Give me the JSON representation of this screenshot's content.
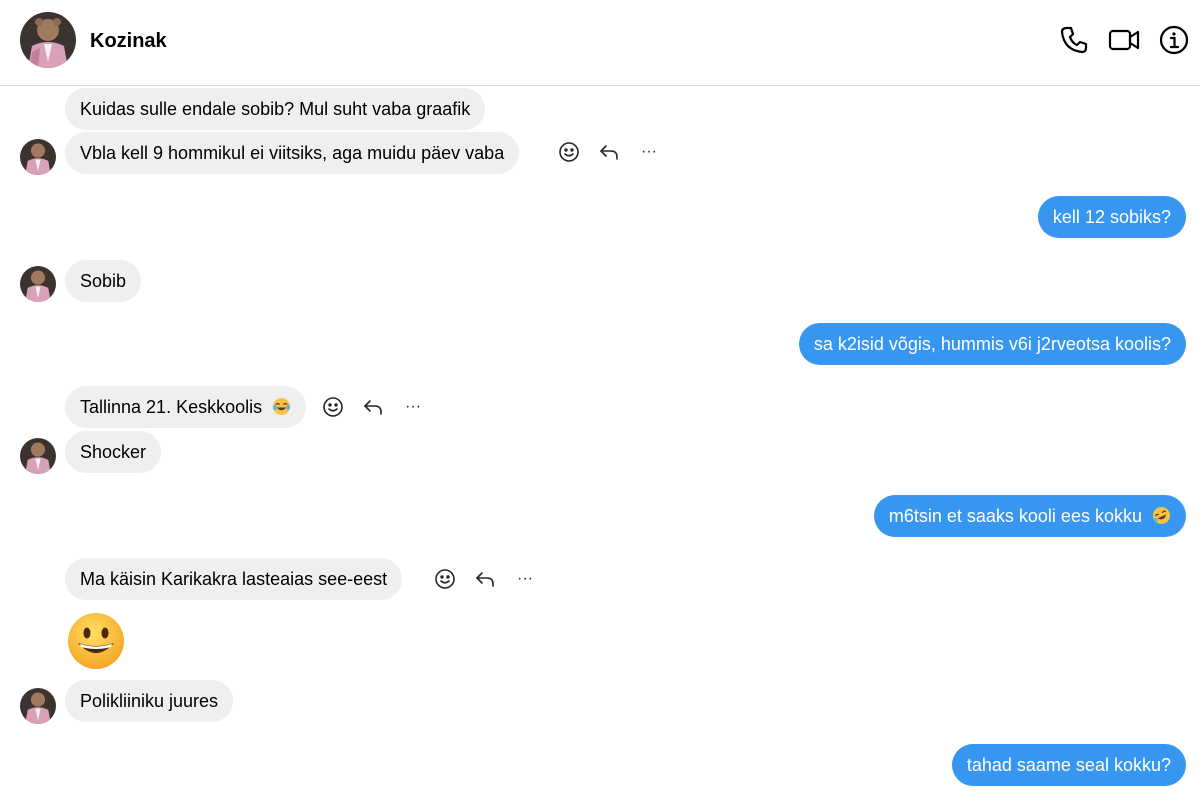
{
  "header": {
    "contact_name": "Kozinak",
    "icons": [
      "phone-icon",
      "video-call-icon",
      "info-icon"
    ]
  },
  "colors": {
    "incoming_bubble": "#efefef",
    "outgoing_bubble": "#3797f0",
    "outgoing_text": "#ffffff",
    "divider": "#dbdbdb"
  },
  "messages": [
    {
      "direction": "incoming",
      "text": "Kuidas sulle endale sobib? Mul suht vaba graafik"
    },
    {
      "direction": "incoming",
      "text": "Vbla kell 9 hommikul ei viitsiks, aga muidu päev vaba"
    },
    {
      "direction": "outgoing",
      "text": "kell 12 sobiks?"
    },
    {
      "direction": "incoming",
      "text": "Sobib"
    },
    {
      "direction": "outgoing",
      "text": "sa k2isid võgis, hummis v6i j2rveotsa koolis?"
    },
    {
      "direction": "incoming",
      "text": "Tallinna 21. Keskkoolis",
      "emoji": "face-with-tears-of-joy"
    },
    {
      "direction": "incoming",
      "text": "Shocker"
    },
    {
      "direction": "outgoing",
      "text": "m6tsin et saaks kooli ees kokku",
      "emoji": "rolling-on-the-floor-laughing"
    },
    {
      "direction": "incoming",
      "text": "Ma käisin Karikakra lasteaias see-eest"
    },
    {
      "direction": "incoming",
      "emoji": "grinning-face"
    },
    {
      "direction": "incoming",
      "text": "Polikliiniku juures"
    },
    {
      "direction": "outgoing",
      "text": "tahad saame seal kokku?"
    }
  ],
  "message_actions": [
    "react-icon",
    "reply-icon",
    "more-icon"
  ],
  "more_glyph": "···"
}
